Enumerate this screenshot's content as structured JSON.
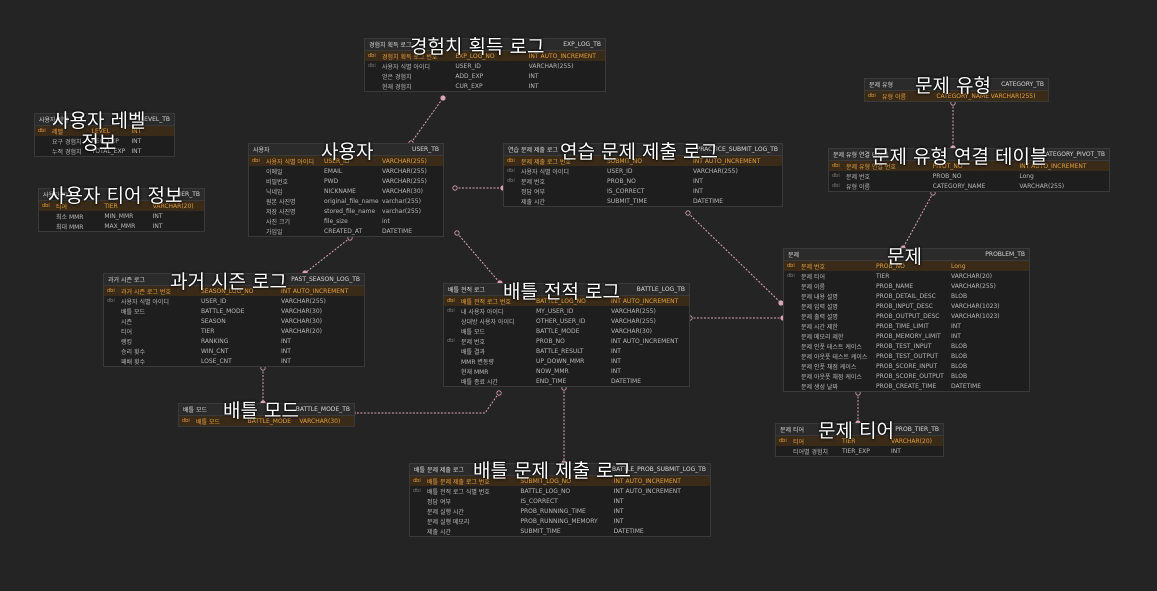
{
  "diagram": {
    "tables": {
      "exp_log": {
        "label": "경험치 획득 로그",
        "name": "EXP_LOG_TB",
        "rows": [
          {
            "key": "dbi",
            "col": "경험치 획득 로그 번호",
            "field": "EXP_LOG_NO",
            "type": "INT AUTO_INCREMENT",
            "pk": true
          },
          {
            "key": "dbi",
            "col": "사용자 식별 아이디",
            "field": "USER_ID",
            "type": "VARCHAR(255)"
          },
          {
            "key": "",
            "col": "얻은 경험치",
            "field": "ADD_EXP",
            "type": "INT"
          },
          {
            "key": "",
            "col": "현재 경험치",
            "field": "CUR_EXP",
            "type": "INT"
          }
        ]
      },
      "level": {
        "label": "사용자 레벨",
        "name": "LEVEL_TB",
        "rows": [
          {
            "key": "dbi",
            "col": "레벨",
            "field": "LEVEL",
            "type": "INT",
            "pk": true
          },
          {
            "key": "",
            "col": "요구 경험치",
            "field": "REQ_EXP",
            "type": "INT"
          },
          {
            "key": "",
            "col": "누적 경험치",
            "field": "TOTAL_EXP",
            "type": "INT"
          }
        ]
      },
      "tier": {
        "label": "사용자 티어",
        "name": "TIER_TB",
        "rows": [
          {
            "key": "dbi",
            "col": "티어",
            "field": "TIER",
            "type": "VARCHAR(20)",
            "pk": true
          },
          {
            "key": "",
            "col": "최소 MMR",
            "field": "MIN_MMR",
            "type": "INT"
          },
          {
            "key": "",
            "col": "최대 MMR",
            "field": "MAX_MMR",
            "type": "INT"
          }
        ]
      },
      "user": {
        "label": "사용자",
        "name": "USER_TB",
        "rows": [
          {
            "key": "dbi",
            "col": "사용자 식별 아이디",
            "field": "USER_ID",
            "type": "VARCHAR(255)",
            "pk": true
          },
          {
            "key": "",
            "col": "이메일",
            "field": "EMAIL",
            "type": "VARCHAR(255)"
          },
          {
            "key": "",
            "col": "비밀번호",
            "field": "PWD",
            "type": "VARCHAR(255)"
          },
          {
            "key": "",
            "col": "닉네임",
            "field": "NICKNAME",
            "type": "VARCHAR(30)"
          },
          {
            "key": "",
            "col": "원본 사진명",
            "field": "original_file_name",
            "type": "varchar(255)"
          },
          {
            "key": "",
            "col": "저장 사진명",
            "field": "stored_file_name",
            "type": "varchar(255)"
          },
          {
            "key": "",
            "col": "사진 크기",
            "field": "file_size",
            "type": "int"
          },
          {
            "key": "",
            "col": "가입일",
            "field": "CREATED_AT",
            "type": "DATETIME"
          }
        ]
      },
      "practice": {
        "label": "연습 문제 제출 로그",
        "name": "PRACTICE_SUBMIT_LOG_TB",
        "rows": [
          {
            "key": "dbi",
            "col": "문제 제출 로그 번호",
            "field": "SUBMIT_NO",
            "type": "INT AUTO_INCREMENT",
            "pk": true
          },
          {
            "key": "dbi",
            "col": "사용자 식별 아이디",
            "field": "USER_ID",
            "type": "VARCHAR(255)"
          },
          {
            "key": "dbi",
            "col": "문제 번호",
            "field": "PROB_NO",
            "type": "INT"
          },
          {
            "key": "",
            "col": "정답 여부",
            "field": "IS_CORRECT",
            "type": "INT"
          },
          {
            "key": "",
            "col": "제출 시간",
            "field": "SUBMIT_TIME",
            "type": "DATETIME"
          }
        ]
      },
      "category": {
        "label": "문제 유형",
        "name": "CATEGORY_TB",
        "rows": [
          {
            "key": "dbi",
            "col": "유형 이름",
            "field": "CATEGORY_NAME",
            "type": "VARCHAR(255)",
            "pk": true
          }
        ]
      },
      "category_pivot": {
        "label": "문제 유형 연결 테이블",
        "name": "CATEGORY_PIVOT_TB",
        "rows": [
          {
            "key": "dbi",
            "col": "문제 유형 연결 번호",
            "field": "PIVOT_NO",
            "type": "INT AUTO_INCREMENT",
            "pk": true
          },
          {
            "key": "dbi",
            "col": "문제 번호",
            "field": "PROB_NO",
            "type": "Long"
          },
          {
            "key": "dbi",
            "col": "유형 이름",
            "field": "CATEGORY_NAME",
            "type": "VARCHAR(255)"
          }
        ]
      },
      "problem": {
        "label": "문제",
        "name": "PROBLEM_TB",
        "rows": [
          {
            "key": "dbi",
            "col": "문제 번호",
            "field": "PROB_NO",
            "type": "Long",
            "pk": true
          },
          {
            "key": "dbi",
            "col": "문제 티어",
            "field": "TIER",
            "type": "VARCHAR(20)"
          },
          {
            "key": "",
            "col": "문제 이름",
            "field": "PROB_NAME",
            "type": "VARCHAR(255)"
          },
          {
            "key": "",
            "col": "문제 내용 설명",
            "field": "PROB_DETAIL_DESC",
            "type": "BLOB"
          },
          {
            "key": "",
            "col": "문제 입력 설명",
            "field": "PROB_INPUT_DESC",
            "type": "VARCHAR(1023)"
          },
          {
            "key": "",
            "col": "문제 출력 설명",
            "field": "PROB_OUTPUT_DESC",
            "type": "VARCHAR(1023)"
          },
          {
            "key": "",
            "col": "문제 시간 제한",
            "field": "PROB_TIME_LIMIT",
            "type": "INT"
          },
          {
            "key": "",
            "col": "문제 메모리 제한",
            "field": "PROB_MEMORY_LIMIT",
            "type": "INT"
          },
          {
            "key": "",
            "col": "문제 인풋 테스트 케이스",
            "field": "PROB_TEST_INPUT",
            "type": "BLOB"
          },
          {
            "key": "",
            "col": "문제 아웃풋 테스트 케이스",
            "field": "PROB_TEST_OUTPUT",
            "type": "BLOB"
          },
          {
            "key": "",
            "col": "문제 인풋 채점 케이스",
            "field": "PROB_SCORE_INPUT",
            "type": "BLOB"
          },
          {
            "key": "",
            "col": "문제 아웃풋 채점 케이스",
            "field": "PROB_SCORE_OUTPUT",
            "type": "BLOB"
          },
          {
            "key": "",
            "col": "문제 생성 날짜",
            "field": "PROB_CREATE_TIME",
            "type": "DATETIME"
          }
        ]
      },
      "past_season": {
        "label": "과거 시즌 로그",
        "name": "PAST_SEASON_LOG_TB",
        "rows": [
          {
            "key": "dbi",
            "col": "과거 시즌 로그 번호",
            "field": "SEASON_LOG_NO",
            "type": "INT AUTO_INCREMENT",
            "pk": true
          },
          {
            "key": "dbi",
            "col": "사용자 식별 아이디",
            "field": "USER_ID",
            "type": "VARCHAR(255)"
          },
          {
            "key": "",
            "col": "배틀 모드",
            "field": "BATTLE_MODE",
            "type": "VARCHAR(30)"
          },
          {
            "key": "",
            "col": "시즌",
            "field": "SEASON",
            "type": "VARCHAR(30)"
          },
          {
            "key": "",
            "col": "티어",
            "field": "TIER",
            "type": "VARCHAR(20)"
          },
          {
            "key": "",
            "col": "랭킹",
            "field": "RANKING",
            "type": "INT"
          },
          {
            "key": "",
            "col": "승리 횟수",
            "field": "WIN_CNT",
            "type": "INT"
          },
          {
            "key": "",
            "col": "패배 횟수",
            "field": "LOSE_CNT",
            "type": "INT"
          }
        ]
      },
      "battle_log": {
        "label": "배틀 전적 로그",
        "name": "BATTLE_LOG_TB",
        "rows": [
          {
            "key": "dbi",
            "col": "배틀 전적 로그 번호",
            "field": "BATTLE_LOG_NO",
            "type": "INT AUTO_INCREMENT",
            "pk": true
          },
          {
            "key": "dbi",
            "col": "내 사용자 아이디",
            "field": "MY_USER_ID",
            "type": "VARCHAR(255)"
          },
          {
            "key": "",
            "col": "상대방 사용자 아이디",
            "field": "OTHER_USER_ID",
            "type": "VARCHAR(255)"
          },
          {
            "key": "",
            "col": "배틀 모드",
            "field": "BATTLE_MODE",
            "type": "VARCHAR(30)"
          },
          {
            "key": "dbi",
            "col": "문제 번호",
            "field": "PROB_NO",
            "type": "INT AUTO_INCREMENT"
          },
          {
            "key": "",
            "col": "배틀 결과",
            "field": "BATTLE_RESULT",
            "type": "INT"
          },
          {
            "key": "",
            "col": "MMR 변동량",
            "field": "UP_DOWN_MMR",
            "type": "INT"
          },
          {
            "key": "",
            "col": "현재 MMR",
            "field": "NOW_MMR",
            "type": "INT"
          },
          {
            "key": "",
            "col": "배틀 종료 시간",
            "field": "END_TIME",
            "type": "DATETIME"
          }
        ]
      },
      "battle_mode": {
        "label": "배틀 모드",
        "name": "BATTLE_MODE_TB",
        "rows": [
          {
            "key": "dbi",
            "col": "배틀 모드",
            "field": "BATTLE_MODE",
            "type": "VARCHAR(30)",
            "pk": true
          }
        ]
      },
      "prob_tier": {
        "label": "문제 티어",
        "name": "PROB_TIER_TB",
        "rows": [
          {
            "key": "dbi",
            "col": "티어",
            "field": "TIER",
            "type": "VARCHAR(20)",
            "pk": true
          },
          {
            "key": "",
            "col": "티어별 경험치",
            "field": "TIER_EXP",
            "type": "INT"
          }
        ]
      },
      "battle_submit": {
        "label": "배틀 문제 제출 로그",
        "name": "BATTLE_PROB_SUBMIT_LOG_TB",
        "rows": [
          {
            "key": "dbi",
            "col": "배틀 문제 제출 로그 번호",
            "field": "SUBMIT_LOG_NO",
            "type": "INT AUTO_INCREMENT",
            "pk": true
          },
          {
            "key": "dbi",
            "col": "배틀 전적 로그 식별 번호",
            "field": "BATTLE_LOG_NO",
            "type": "INT AUTO_INCREMENT"
          },
          {
            "key": "",
            "col": "정답 여부",
            "field": "IS_CORRECT",
            "type": "INT"
          },
          {
            "key": "",
            "col": "문제 실행 시간",
            "field": "PROB_RUNNING_TIME",
            "type": "INT"
          },
          {
            "key": "",
            "col": "문제 실행 메모리",
            "field": "PROB_RUNNING_MEMORY",
            "type": "INT"
          },
          {
            "key": "",
            "col": "제출 시간",
            "field": "SUBMIT_TIME",
            "type": "DATETIME"
          }
        ]
      }
    },
    "captions": {
      "exp_log": "경험치 획득 로그",
      "level": "사용자 레벨\n정보",
      "tier": "사용자 티어 정보",
      "user": "사용자",
      "practice": "연습 문제 제출 로그",
      "category": "문제 유형",
      "category_pivot": "문제 유형 연결 테이블",
      "problem": "문제",
      "past_season": "과거 시즌 로그",
      "battle_log": "배틀 전적 로그",
      "battle_mode": "배틀 모드",
      "prob_tier": "문제 티어",
      "battle_submit": "배틀 문제 제출 로그"
    },
    "colors": {
      "link": "#d9a4b8",
      "pk_row": "#3a2a18",
      "pk_text": "#e0a040"
    }
  }
}
